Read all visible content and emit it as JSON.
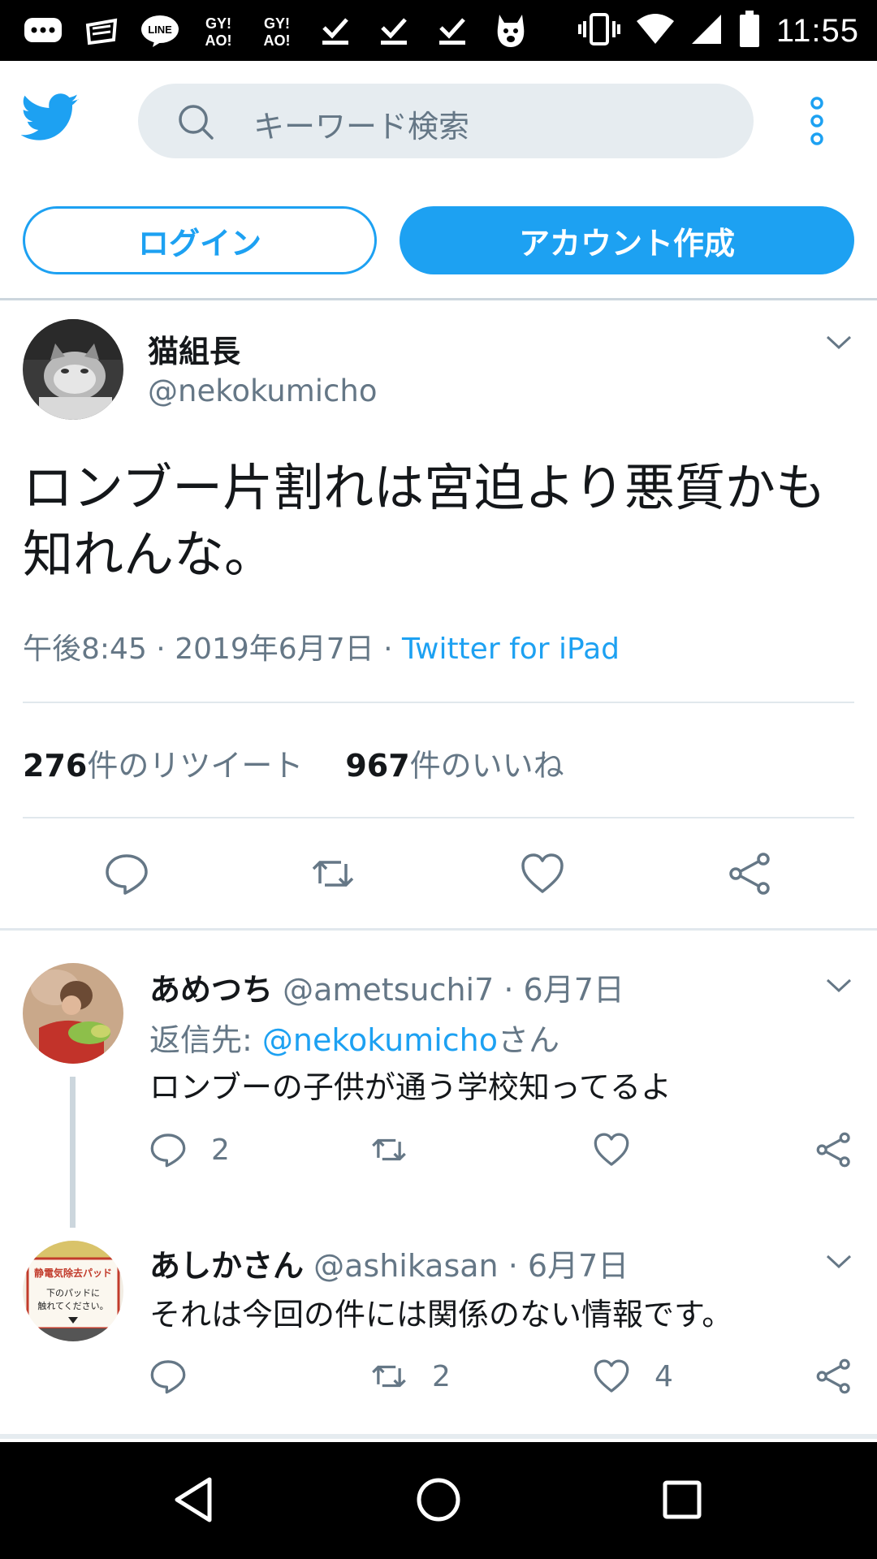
{
  "status_bar": {
    "time": "11:55",
    "left_icons": [
      "chat-bubble-notification-icon",
      "cloud-app-notification-icon",
      "line-app-icon",
      "gyao-app-icon",
      "gyao-app-icon",
      "download-complete-icon",
      "download-complete-icon",
      "download-complete-icon",
      "app-character-icon"
    ],
    "left_labels": {
      "line": "LINE",
      "gyao1_top": "GY!",
      "gyao1_bottom": "AO!",
      "gyao2_top": "GY!",
      "gyao2_bottom": "AO!"
    },
    "right_icons": [
      "vibrate-icon",
      "wifi-icon",
      "cellular-signal-icon",
      "battery-icon"
    ]
  },
  "header": {
    "search_placeholder": "キーワード検索",
    "login_label": "ログイン",
    "signup_label": "アカウント作成"
  },
  "tweet": {
    "display_name": "猫組長",
    "handle": "@nekokumicho",
    "text_line1": "ロンブー片割れは宮迫より悪質かも",
    "text_line2": "知れんな。",
    "time": "午後8:45",
    "sep1": " · ",
    "date": "2019年6月7日",
    "sep2": " · ",
    "source": "Twitter for iPad",
    "retweet_count": "276",
    "retweet_label": "件のリツイート",
    "like_count": "967",
    "like_label": "件のいいね"
  },
  "replies": [
    {
      "display_name": "あめつち",
      "handle": "@ametsuchi7",
      "sep": " · ",
      "date": "6月7日",
      "reply_to_prefix": "返信先: ",
      "reply_to_mention": "@nekokumicho",
      "reply_to_suffix": "さん",
      "text": "ロンブーの子供が通う学校知ってるよ",
      "reply_count": "2",
      "retweet_count": "",
      "like_count": ""
    },
    {
      "display_name": "あしかさん",
      "handle": "@ashikasan",
      "sep": " · ",
      "date": "6月7日",
      "text": "それは今回の件には関係のない情報です。",
      "avatar_sign_line1": "静電気除去パッド",
      "avatar_sign_line2": "下のパッドに",
      "avatar_sign_line3": "触れてください。",
      "reply_count": "",
      "retweet_count": "2",
      "like_count": "4"
    }
  ],
  "colors": {
    "accent": "#1da1f2",
    "secondary_text": "#657786",
    "primary_text": "#14171a",
    "search_bg": "#e6ecf0",
    "divider": "#e1e8ed"
  }
}
